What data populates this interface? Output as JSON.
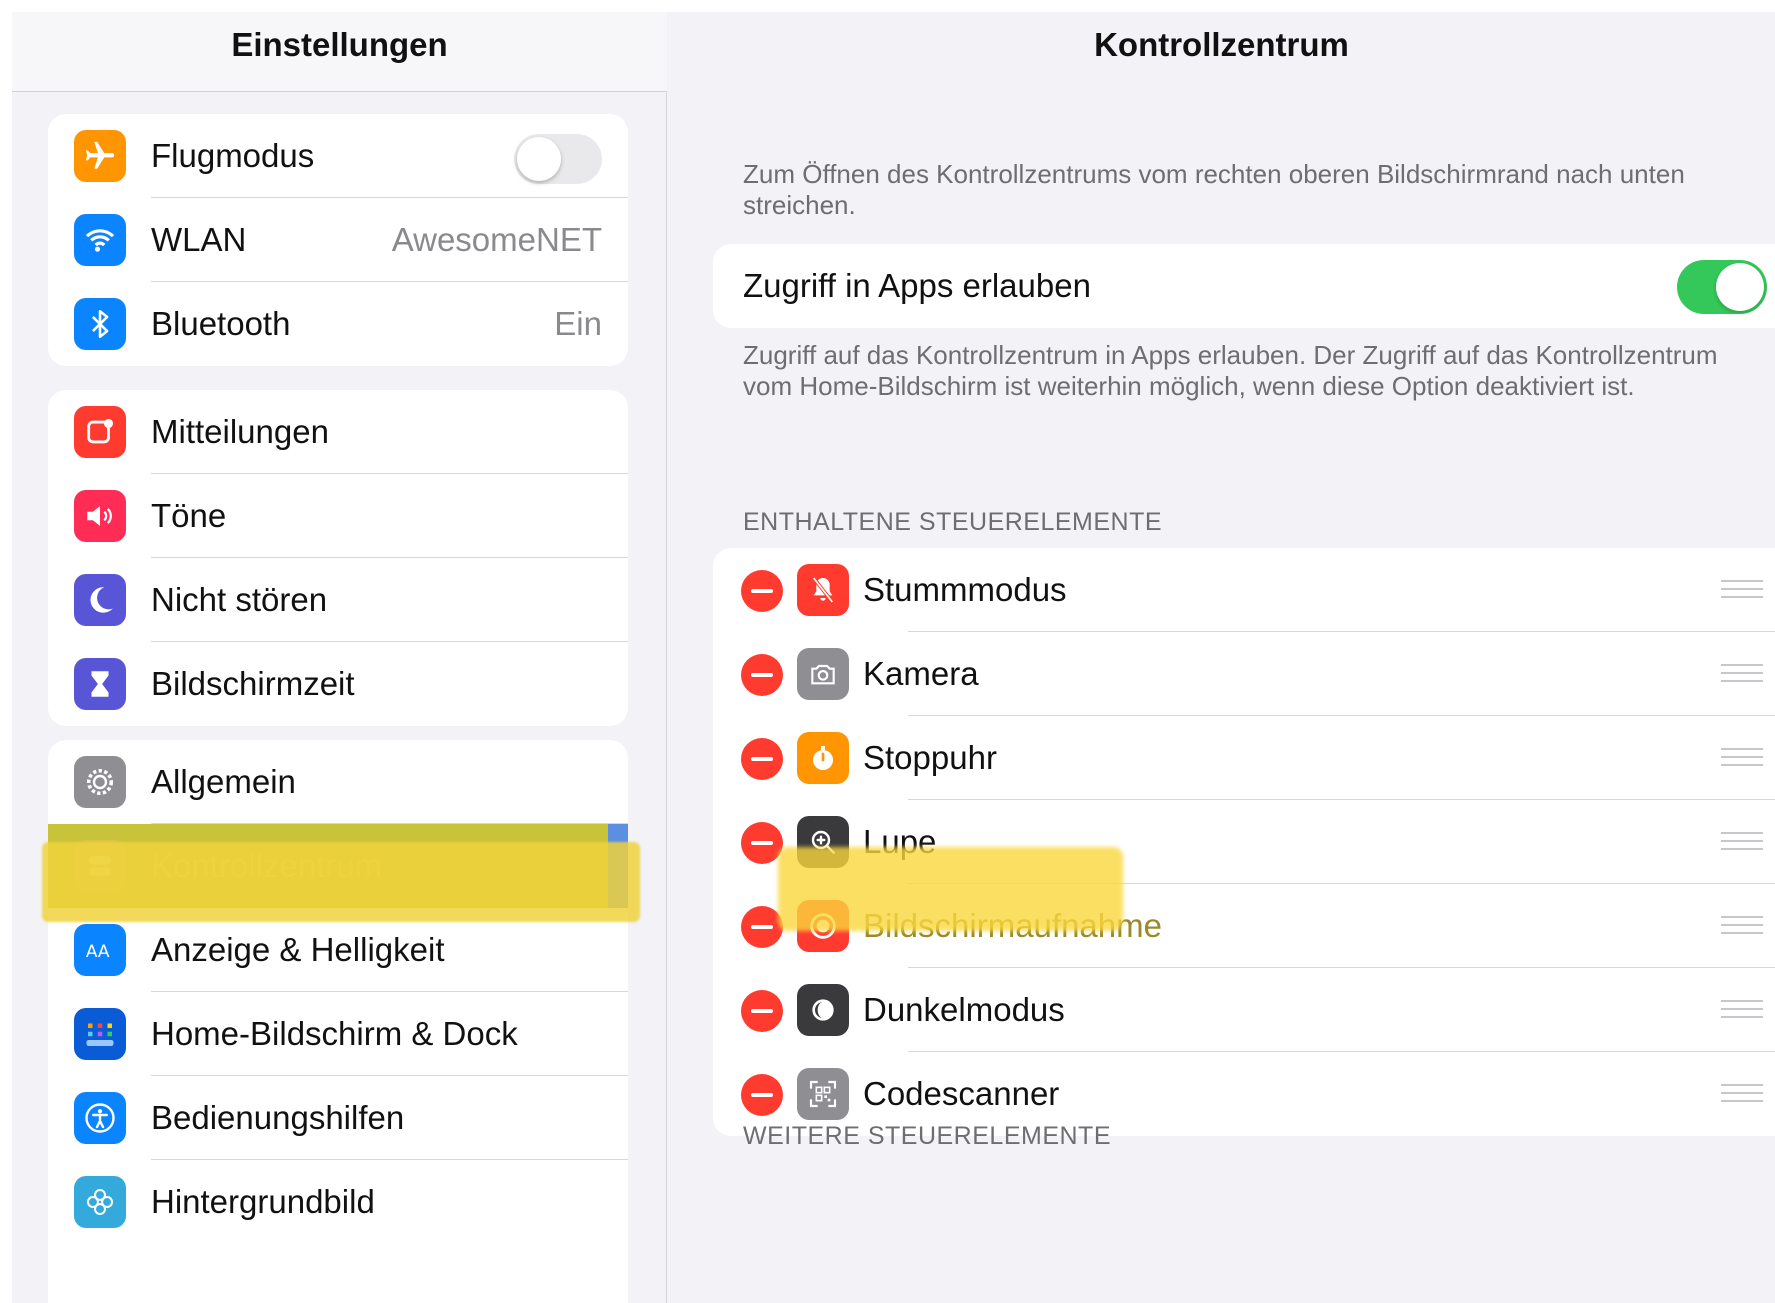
{
  "sidebar": {
    "title": "Einstellungen",
    "group1": [
      {
        "label": "Flugmodus",
        "icon": "airplane-icon",
        "color": "#ff9500",
        "toggle": false
      },
      {
        "label": "WLAN",
        "icon": "wifi-icon",
        "color": "#0a84ff",
        "value": "AwesomeNET"
      },
      {
        "label": "Bluetooth",
        "icon": "bluetooth-icon",
        "color": "#0a84ff",
        "value": "Ein"
      }
    ],
    "group2": [
      {
        "label": "Mitteilungen",
        "icon": "notifications-icon",
        "color": "#ff3b30"
      },
      {
        "label": "Töne",
        "icon": "speaker-icon",
        "color": "#ff2d55"
      },
      {
        "label": "Nicht stören",
        "icon": "moon-icon",
        "color": "#5856d6"
      },
      {
        "label": "Bildschirmzeit",
        "icon": "hourglass-icon",
        "color": "#5856d6"
      }
    ],
    "group3": [
      {
        "label": "Allgemein",
        "icon": "gear-icon",
        "color": "#8e8e93"
      },
      {
        "label": "Kontrollzentrum",
        "icon": "switches-icon",
        "color": "#8e8e93",
        "selected": true
      },
      {
        "label": "Anzeige & Helligkeit",
        "icon": "text-size-icon",
        "color": "#0a84ff"
      },
      {
        "label": "Home-Bildschirm & Dock",
        "icon": "grid-icon",
        "color": "#0a5bd6"
      },
      {
        "label": "Bedienungshilfen",
        "icon": "accessibility-icon",
        "color": "#0a84ff"
      },
      {
        "label": "Hintergrundbild",
        "icon": "flower-icon",
        "color": "#34aadc"
      }
    ]
  },
  "detail": {
    "title": "Kontrollzentrum",
    "intro": "Zum Öffnen des Kontrollzentrums vom rechten oberen Bildschirmrand nach unten streichen.",
    "access_label": "Zugriff in Apps erlauben",
    "access_toggle": true,
    "access_desc": "Zugriff auf das Kontrollzentrum in Apps erlauben. Der Zugriff auf das Kontrollzentrum vom Home-Bildschirm ist weiterhin möglich, wenn diese Option deaktiviert ist.",
    "included_header": "ENTHALTENE STEUERELEMENTE",
    "included": [
      {
        "label": "Stummmodus",
        "icon": "bell-slash-icon",
        "color": "#ff3b30"
      },
      {
        "label": "Kamera",
        "icon": "camera-icon",
        "color": "#8e8e93"
      },
      {
        "label": "Stoppuhr",
        "icon": "stopwatch-icon",
        "color": "#ff9500"
      },
      {
        "label": "Lupe",
        "icon": "magnifier-icon",
        "color": "#3a3a3c"
      },
      {
        "label": "Bildschirmaufnahme",
        "icon": "record-icon",
        "color": "#ff3b30",
        "highlighted": true
      },
      {
        "label": "Dunkelmodus",
        "icon": "dark-mode-icon",
        "color": "#3a3a3c"
      },
      {
        "label": "Codescanner",
        "icon": "qr-code-icon",
        "color": "#8e8e93"
      }
    ],
    "more_header": "WEITERE STEUERELEMENTE"
  }
}
